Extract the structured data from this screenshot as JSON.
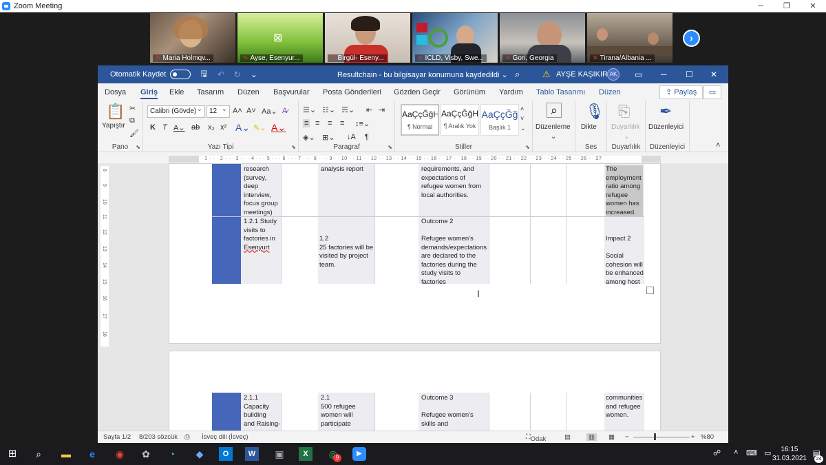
{
  "zoom": {
    "window_title": "Zoom Meeting",
    "participants": [
      {
        "name": "Maria Holmqv..."
      },
      {
        "name": "Ayse, Esenyur..."
      },
      {
        "name": "Birgül- Eseny..."
      },
      {
        "name": "ICLD, Visby, Swe..."
      },
      {
        "name": "Gori, Georgia"
      },
      {
        "name": "Tirana/Albania ..."
      }
    ],
    "next_glyph": "›"
  },
  "word": {
    "autosave_label": "Otomatik Kaydet",
    "doc_title": "Resultchain  -  bu bilgisayar konumuna kaydedildi  ⌄",
    "user_name": "AYŞE KAŞIKIRIK",
    "user_initials": "AK",
    "menu": [
      "Dosya",
      "Giriş",
      "Ekle",
      "Tasarım",
      "Düzen",
      "Başvurular",
      "Posta Gönderileri",
      "Gözden Geçir",
      "Görünüm",
      "Yardım",
      "Tablo Tasarımı",
      "Düzen"
    ],
    "share_label": "Paylaş",
    "ribbon": {
      "pano": {
        "label": "Pano",
        "paste": "Yapıştır"
      },
      "font": {
        "label": "Yazı Tipi",
        "family": "Calibri (Gövde)",
        "size": "12"
      },
      "paragraph": {
        "label": "Paragraf"
      },
      "styles": {
        "label": "Stiller",
        "items": [
          {
            "sample": "AaÇçĞğH",
            "name": "¶ Normal"
          },
          {
            "sample": "AaÇçĞğH",
            "name": "¶ Aralık Yok"
          },
          {
            "sample": "AaÇçĞğ",
            "name": "Başlık 1"
          }
        ]
      },
      "editing": {
        "label": "Düzenleme"
      },
      "voice": {
        "label": "Ses",
        "button": "Dikte"
      },
      "sensitivity": {
        "label": "Duyarlılık",
        "button": "Duyarlılık"
      },
      "editor": {
        "label": "Düzenleyici",
        "button": "Düzenleyici"
      }
    },
    "ruler_text": "· 2 · 1 · 1 · · · 1 · · · 2 · · · 3 · · · 4 · · · 5 · · · 6 · · · 7 · · · 8 · · · 9 · · 10 · · 11 · · 12 · · 13 · · 14 · · 15 · · 16 · · 17 · · 18 · · 19 · · 20 · · 21 · · 22 · · 23 · · 24 · · 25 · · 26 · · 27",
    "vruler": [
      "8",
      "9",
      "10",
      "11",
      "12",
      "13",
      "14",
      "15",
      "16",
      "17",
      "18"
    ],
    "table_page1": {
      "row1": {
        "c1": "research\n(survey,\ndeep\ninterview,\nfocus group\nmeetings)",
        "c2": "analysis report",
        "c3": "requirements, and\nexpectations of\nrefugee women from\nlocal authorities.",
        "c4": "The\nemployment\nratio among\nrefugee\nwomen has\nincreased."
      },
      "row2": {
        "c1a": "1.2.1 Study\nvisits to\nfactories in\n",
        "c1b": "Esenyurt",
        "c2": "1.2\n25 factories will be\nvisited by project\nteam.",
        "c3": "Outcome 2\n\nRefugee women's\ndemands/expectations\nare declared to the\nfactories during the\nstudy visits to\nfactories",
        "c4": "Impact 2\n\nSocial\ncohesion will\nbe enhanced\namong host"
      }
    },
    "table_page2": {
      "c1": "2.1.1\nCapacity\nbuilding\nand Raising-",
      "c2": "2.1\n500 refugee\nwomen will\nparticipate",
      "c3": "Outcome 3\n\nRefugee women's\nskills and",
      "c4": "communities\nand refugee\nwomen."
    },
    "status": {
      "page": "Sayfa 1/2",
      "words": "8/203 sözcük",
      "language": "İsveç dili (İsveç)",
      "focus": "Odak",
      "zoom": "%80"
    }
  },
  "taskbar": {
    "time": "16:15",
    "date": "31.03.2021",
    "notification_count": "24",
    "whatsapp_badge": "9"
  }
}
